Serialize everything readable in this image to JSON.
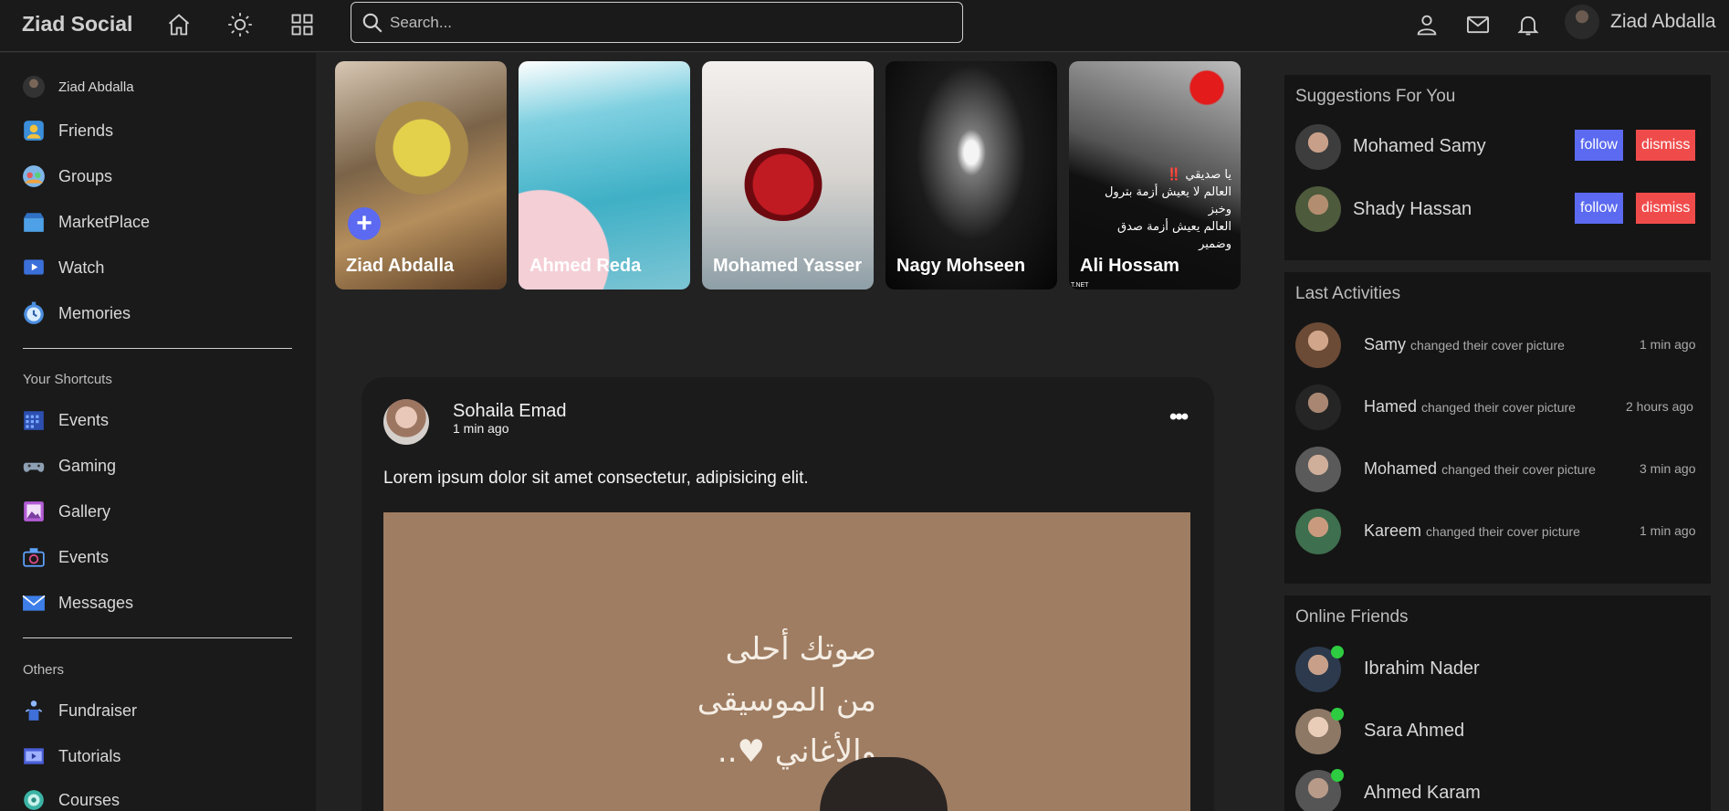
{
  "navbar": {
    "brand": "Ziad Social",
    "search_placeholder": "Search...",
    "user_name": "Ziad Abdalla",
    "icons": [
      "home-icon",
      "sun-icon",
      "grid-icon",
      "user-icon",
      "mail-icon",
      "bell-icon"
    ]
  },
  "sidebar": {
    "user": "Ziad Abdalla",
    "main_items": [
      {
        "label": "Friends",
        "icon": "friends-icon"
      },
      {
        "label": "Groups",
        "icon": "groups-icon"
      },
      {
        "label": "MarketPlace",
        "icon": "marketplace-icon"
      },
      {
        "label": "Watch",
        "icon": "watch-icon"
      },
      {
        "label": "Memories",
        "icon": "memories-icon"
      }
    ],
    "shortcuts_heading": "Your Shortcuts",
    "shortcuts": [
      {
        "label": "Events",
        "icon": "events-icon"
      },
      {
        "label": "Gaming",
        "icon": "gaming-icon"
      },
      {
        "label": "Gallery",
        "icon": "gallery-icon"
      },
      {
        "label": "Events",
        "icon": "camera-icon"
      },
      {
        "label": "Messages",
        "icon": "messages-icon"
      }
    ],
    "others_heading": "Others",
    "others": [
      {
        "label": "Fundraiser",
        "icon": "fundraiser-icon"
      },
      {
        "label": "Tutorials",
        "icon": "tutorials-icon"
      },
      {
        "label": "Courses",
        "icon": "courses-icon"
      }
    ]
  },
  "stories": [
    {
      "name": "Ziad Abdalla",
      "add_label": "+"
    },
    {
      "name": "Ahmed Reda"
    },
    {
      "name": "Mohamed Yasser"
    },
    {
      "name": "Nagy Mohseen"
    },
    {
      "name": "Ali Hossam",
      "overlay_lines": [
        "يا صديقي ‼️",
        "العالم لا يعيش أزمة بترول وخبز",
        "العالم يعيش أزمة صدق وضمير"
      ],
      "watermark": "T.NET"
    }
  ],
  "post": {
    "author": "Sohaila Emad",
    "time": "1 min ago",
    "more": "•••",
    "text": "Lorem ipsum dolor sit amet consectetur, adipisicing elit.",
    "image_text": [
      "صوتك أحلى",
      "من الموسيقى",
      "والأغاني ♥.."
    ]
  },
  "suggestions": {
    "title": "Suggestions For You",
    "follow_label": "follow",
    "dismiss_label": "dismiss",
    "people": [
      {
        "name": "Mohamed Samy"
      },
      {
        "name": "Shady Hassan"
      }
    ]
  },
  "activities": {
    "title": "Last Activities",
    "items": [
      {
        "name": "Samy",
        "action": "changed their cover picture",
        "time": "1 min ago"
      },
      {
        "name": "Hamed",
        "action": "changed their cover picture",
        "time": "2 hours ago"
      },
      {
        "name": "Mohamed",
        "action": "changed their cover picture",
        "time": "3 min ago"
      },
      {
        "name": "Kareem",
        "action": "changed their cover picture",
        "time": "1 min ago"
      }
    ]
  },
  "online": {
    "title": "Online Friends",
    "friends": [
      {
        "name": "Ibrahim Nader"
      },
      {
        "name": "Sara Ahmed"
      },
      {
        "name": "Ahmed Karam"
      }
    ]
  },
  "colors": {
    "background": "#222222",
    "panel": "#151515",
    "accent": "#5b6af0",
    "danger": "#f04b4b",
    "online": "#2ecc40"
  }
}
